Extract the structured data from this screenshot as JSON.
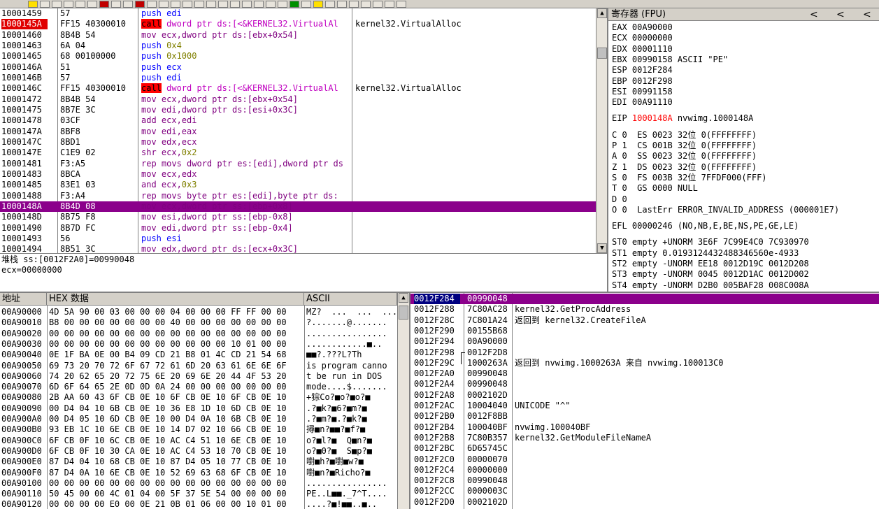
{
  "toolbar": {
    "buttons": [
      "button",
      "button",
      "button",
      "button",
      "button",
      "button",
      "button",
      "button",
      "button",
      "button",
      "button",
      "button",
      "button",
      "button",
      "button",
      "button",
      "button",
      "button",
      "button",
      "button",
      "button",
      "button",
      "button",
      "button",
      "button",
      "button",
      "button",
      "button",
      "button",
      "button",
      "button",
      "button"
    ]
  },
  "disasm": {
    "rows": [
      {
        "addr": "10001459",
        "hex": "57",
        "asm": [
          {
            "t": "push",
            "k": "push"
          },
          {
            "t": " edi",
            "k": "push"
          }
        ],
        "comment": ""
      },
      {
        "addr": "1000145A",
        "hex": "FF15 40300010",
        "asm": [
          {
            "t": "call",
            "k": "call-tag"
          },
          {
            "t": " dword ptr ds:[<&KERNEL32.VirtualAl",
            "k": "call"
          }
        ],
        "comment": "kernel32.VirtualAlloc",
        "state": "bp"
      },
      {
        "addr": "10001460",
        "hex": "8B4B 54",
        "asm": [
          {
            "t": "mov ecx,dword ptr ds:[ebx+0x54]",
            "k": "mov"
          }
        ],
        "comment": ""
      },
      {
        "addr": "10001463",
        "hex": "6A 04",
        "asm": [
          {
            "t": "push",
            "k": "push"
          },
          {
            "t": " 0x4",
            "k": "num"
          }
        ],
        "comment": ""
      },
      {
        "addr": "10001465",
        "hex": "68 00100000",
        "asm": [
          {
            "t": "push",
            "k": "push"
          },
          {
            "t": " 0x1000",
            "k": "num"
          }
        ],
        "comment": ""
      },
      {
        "addr": "1000146A",
        "hex": "51",
        "asm": [
          {
            "t": "push ecx",
            "k": "push"
          }
        ],
        "comment": ""
      },
      {
        "addr": "1000146B",
        "hex": "57",
        "asm": [
          {
            "t": "push edi",
            "k": "push"
          }
        ],
        "comment": ""
      },
      {
        "addr": "1000146C",
        "hex": "FF15 40300010",
        "asm": [
          {
            "t": "call",
            "k": "call-tag"
          },
          {
            "t": " dword ptr ds:[<&KERNEL32.VirtualAl",
            "k": "call"
          }
        ],
        "comment": "kernel32.VirtualAlloc"
      },
      {
        "addr": "10001472",
        "hex": "8B4B 54",
        "asm": [
          {
            "t": "mov ecx,dword ptr ds:[ebx+0x54]",
            "k": "mov"
          }
        ],
        "comment": ""
      },
      {
        "addr": "10001475",
        "hex": "8B7E 3C",
        "asm": [
          {
            "t": "mov edi,dword ptr ds:[esi+0x3C]",
            "k": "mov"
          }
        ],
        "comment": ""
      },
      {
        "addr": "10001478",
        "hex": "03CF",
        "asm": [
          {
            "t": "add ecx,edi",
            "k": "add"
          }
        ],
        "comment": ""
      },
      {
        "addr": "1000147A",
        "hex": "8BF8",
        "asm": [
          {
            "t": "mov edi,eax",
            "k": "mov"
          }
        ],
        "comment": ""
      },
      {
        "addr": "1000147C",
        "hex": "8BD1",
        "asm": [
          {
            "t": "mov edx,ecx",
            "k": "mov"
          }
        ],
        "comment": ""
      },
      {
        "addr": "1000147E",
        "hex": "C1E9 02",
        "asm": [
          {
            "t": "shr ecx,",
            "k": "mov"
          },
          {
            "t": "0x2",
            "k": "num"
          }
        ],
        "comment": ""
      },
      {
        "addr": "10001481",
        "hex": "F3:A5",
        "asm": [
          {
            "t": "rep movs dword ptr es:[edi],dword ptr ds",
            "k": "rep"
          }
        ],
        "comment": ""
      },
      {
        "addr": "10001483",
        "hex": "8BCA",
        "asm": [
          {
            "t": "mov ecx,edx",
            "k": "mov"
          }
        ],
        "comment": ""
      },
      {
        "addr": "10001485",
        "hex": "83E1 03",
        "asm": [
          {
            "t": "and ecx,",
            "k": "mov"
          },
          {
            "t": "0x3",
            "k": "num"
          }
        ],
        "comment": ""
      },
      {
        "addr": "10001488",
        "hex": "F3:A4",
        "asm": [
          {
            "t": "rep movs byte ptr es:[edi],byte ptr ds:",
            "k": "rep"
          }
        ],
        "comment": ""
      },
      {
        "addr": "1000148A",
        "hex": "8B4D 08",
        "asm": [
          {
            "t": "mov ecx,dword ptr ss:[ebp+0x8]",
            "k": "mov"
          }
        ],
        "comment": "",
        "state": "cur"
      },
      {
        "addr": "1000148D",
        "hex": "8B75 F8",
        "asm": [
          {
            "t": "mov esi,dword ptr ss:[ebp-0x8]",
            "k": "mov"
          }
        ],
        "comment": ""
      },
      {
        "addr": "10001490",
        "hex": "8B7D FC",
        "asm": [
          {
            "t": "mov edi,dword ptr ss:[ebp-0x4]",
            "k": "mov"
          }
        ],
        "comment": ""
      },
      {
        "addr": "10001493",
        "hex": "56",
        "asm": [
          {
            "t": "push esi",
            "k": "push"
          }
        ],
        "comment": ""
      },
      {
        "addr": "10001494",
        "hex": "8B51 3C",
        "asm": [
          {
            "t": "mov edx,dword ptr ds:[ecx+0x3C]",
            "k": "mov"
          }
        ],
        "comment": ""
      }
    ]
  },
  "info": {
    "line1": "堆栈 ss:[0012F2A0]=00990048",
    "line2": "ecx=00000000"
  },
  "registers": {
    "title": "寄存器 (FPU)",
    "nav": [
      "<",
      "<",
      "<"
    ],
    "gp": [
      "EAX 00A90000",
      "ECX 00000000",
      "EDX 00001110",
      "EBX 00990158 ASCII \"PE\"",
      "ESP 0012F284",
      "EBP 0012F298",
      "ESI 00991158",
      "EDI 00A91110"
    ],
    "eip_label": "EIP ",
    "eip_value": "1000148A",
    "eip_comment": " nvwimg.1000148A",
    "flags": [
      "C 0  ES 0023 32位 0(FFFFFFFF)",
      "P 1  CS 001B 32位 0(FFFFFFFF)",
      "A 0  SS 0023 32位 0(FFFFFFFF)",
      "Z 1  DS 0023 32位 0(FFFFFFFF)",
      "S 0  FS 003B 32位 7FFDF000(FFF)",
      "T 0  GS 0000 NULL",
      "D 0",
      "O 0  LastErr ERROR_INVALID_ADDRESS (000001E7)"
    ],
    "efl": "EFL 00000246 (NO,NB,E,BE,NS,PE,GE,LE)",
    "fpu": [
      "ST0 empty +UNORM 3E6F 7C99E4C0 7C930970",
      "ST1 empty 0.0193124432488346560e-4933",
      "ST2 empty -UNORM EE18 0012D19C 0012D208",
      "ST3 empty -UNORM 0045 0012D1AC 0012D002",
      "ST4 empty -UNORM D2B0 005BAF28 008C008A"
    ]
  },
  "dump": {
    "headers": {
      "addr": "地址",
      "hex": "HEX 数据",
      "ascii": "ASCII"
    },
    "rows": [
      {
        "addr": "00A90000",
        "hex": "4D 5A 90 00 03 00 00 00 04 00 00 00 FF FF 00 00",
        "ascii": "MZ?  ...  ...  ..."
      },
      {
        "addr": "00A90010",
        "hex": "B8 00 00 00 00 00 00 00 40 00 00 00 00 00 00 00",
        "ascii": "?.......@......."
      },
      {
        "addr": "00A90020",
        "hex": "00 00 00 00 00 00 00 00 00 00 00 00 00 00 00 00",
        "ascii": "................"
      },
      {
        "addr": "00A90030",
        "hex": "00 00 00 00 00 00 00 00 00 00 00 00 10 01 00 00",
        "ascii": "............■.."
      },
      {
        "addr": "00A90040",
        "hex": "0E 1F BA 0E 00 B4 09 CD 21 B8 01 4C CD 21 54 68",
        "ascii": "■■?.???L?Th"
      },
      {
        "addr": "00A90050",
        "hex": "69 73 20 70 72 6F 67 72 61 6D 20 63 61 6E 6E 6F",
        "ascii": "is program canno"
      },
      {
        "addr": "00A90060",
        "hex": "74 20 62 65 20 72 75 6E 20 69 6E 20 44 4F 53 20",
        "ascii": "t be run in DOS "
      },
      {
        "addr": "00A90070",
        "hex": "6D 6F 64 65 2E 0D 0D 0A 24 00 00 00 00 00 00 00",
        "ascii": "mode....$......."
      },
      {
        "addr": "00A90080",
        "hex": "2B AA 60 43 6F CB 0E 10 6F CB 0E 10 6F CB 0E 10",
        "ascii": "+猔Co?■o?■o?■"
      },
      {
        "addr": "00A90090",
        "hex": "00 D4 04 10 6B CB 0E 10 36 E8 1D 10 6D CB 0E 10",
        "ascii": ".?■k?■6?■m?■"
      },
      {
        "addr": "00A900A0",
        "hex": "00 D4 05 10 6D CB 0E 10 00 D4 0A 10 6B CB 0E 10",
        "ascii": ".?■m?■.?■k?■"
      },
      {
        "addr": "00A900B0",
        "hex": "93 EB 1C 10 6E CB 0E 10 14 D7 02 10 66 CB 0E 10",
        "ascii": "撏■n?■■?■f?■"
      },
      {
        "addr": "00A900C0",
        "hex": "6F CB 0F 10 6C CB 0E 10 AC C4 51 10 6E CB 0E 10",
        "ascii": "o?■l?■  Q■n?■"
      },
      {
        "addr": "00A900D0",
        "hex": "6F CB 0F 10 30 CA 0E 10 AC C4 53 10 70 CB 0E 10",
        "ascii": "o?■0?■  S■p?■"
      },
      {
        "addr": "00A900E0",
        "hex": "87 D4 04 10 68 CB 0E 10 87 D4 05 10 77 CB 0E 10",
        "ascii": "嚉■h?■嚉■w?■"
      },
      {
        "addr": "00A900F0",
        "hex": "87 D4 0A 10 6E CB 0E 10 52 69 63 68 6F CB 0E 10",
        "ascii": "嚉■n?■Richo?■"
      },
      {
        "addr": "00A90100",
        "hex": "00 00 00 00 00 00 00 00 00 00 00 00 00 00 00 00",
        "ascii": "................"
      },
      {
        "addr": "00A90110",
        "hex": "50 45 00 00 4C 01 04 00 5F 37 5E 54 00 00 00 00",
        "ascii": "PE..L■■._7^T...."
      },
      {
        "addr": "00A90120",
        "hex": "00 00 00 00 E0 00 0E 21 0B 01 06 00 00 10 01 00",
        "ascii": "....?■!■■..■.."
      }
    ]
  },
  "stack": {
    "rows": [
      {
        "addr": "0012F284",
        "val": "00990048",
        "cmt": "",
        "state": "top"
      },
      {
        "addr": "0012F288",
        "val": "7C80AC28",
        "cmt": "kernel32.GetProcAddress"
      },
      {
        "addr": "0012F28C",
        "val": "7C801A24",
        "cmt": "返回到 kernel32.CreateFileA"
      },
      {
        "addr": "0012F290",
        "val": "00155B68",
        "cmt": ""
      },
      {
        "addr": "0012F294",
        "val": "00A90000",
        "cmt": ""
      },
      {
        "addr": "0012F298",
        "val": "0012F2D8",
        "cmt": ""
      },
      {
        "addr": "0012F29C",
        "val": "1000263A",
        "cmt": "返回到 nvwimg.1000263A 来自 nvwimg.100013C0"
      },
      {
        "addr": "0012F2A0",
        "val": "00990048",
        "cmt": ""
      },
      {
        "addr": "0012F2A4",
        "val": "00990048",
        "cmt": ""
      },
      {
        "addr": "0012F2A8",
        "val": "0002102D",
        "cmt": ""
      },
      {
        "addr": "0012F2AC",
        "val": "10004040",
        "cmt": "UNICODE \"^\""
      },
      {
        "addr": "0012F2B0",
        "val": "0012F8BB",
        "cmt": ""
      },
      {
        "addr": "0012F2B4",
        "val": "100040BF",
        "cmt": "nvwimg.100040BF"
      },
      {
        "addr": "0012F2B8",
        "val": "7C80B357",
        "cmt": "kernel32.GetModuleFileNameA"
      },
      {
        "addr": "0012F2BC",
        "val": "6D65745C",
        "cmt": ""
      },
      {
        "addr": "0012F2C0",
        "val": "00000070",
        "cmt": ""
      },
      {
        "addr": "0012F2C4",
        "val": "00000000",
        "cmt": ""
      },
      {
        "addr": "0012F2C8",
        "val": "00990048",
        "cmt": ""
      },
      {
        "addr": "0012F2CC",
        "val": "0000003C",
        "cmt": ""
      },
      {
        "addr": "0012F2D0",
        "val": "0002102D",
        "cmt": ""
      }
    ]
  }
}
